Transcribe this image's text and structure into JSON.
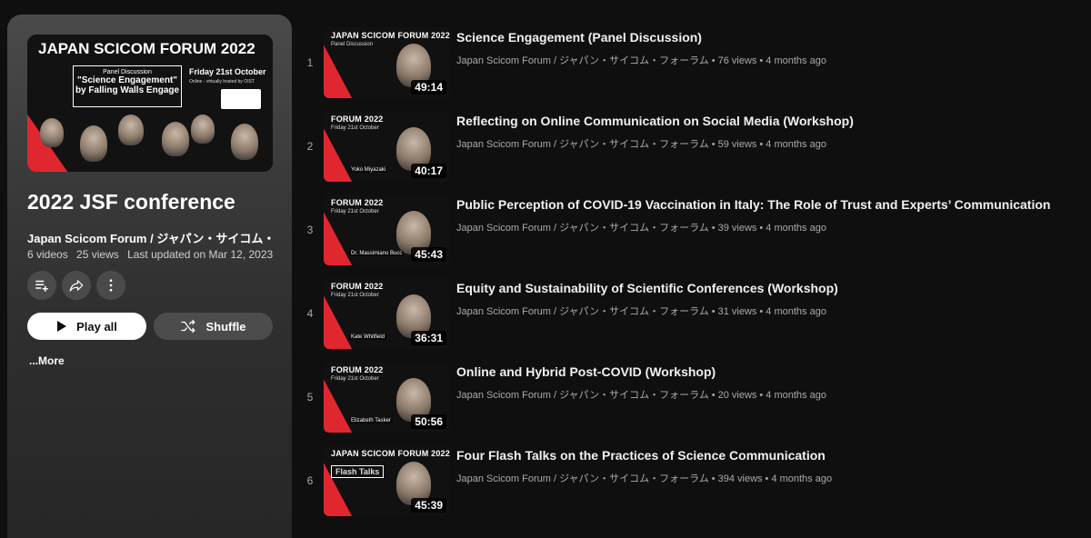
{
  "playlist": {
    "thumb_heading": "JAPAN SCICOM FORUM 2022",
    "thumb_panel": "Panel Discussion",
    "thumb_topic": "\"Science Engagement\"",
    "thumb_by": "by Falling Walls Engage",
    "thumb_date": "Friday 21st October",
    "thumb_online": "Online - virtually hosted by OIST",
    "title": "2022 JSF conference",
    "owner": "Japan Scicom Forum / ジャパン・サイコム・",
    "videos": "6 videos",
    "views": "25 views",
    "updated": "Last updated on Mar 12, 2023",
    "play_all": "Play all",
    "shuffle": "Shuffle",
    "more": "...More"
  },
  "videos": [
    {
      "index": "1",
      "title": "Science Engagement (Panel Discussion)",
      "channel": "Japan Scicom Forum / ジャパン・サイコム・フォーラム",
      "views": "76 views",
      "age": "4 months ago",
      "duration": "49:14",
      "thumb_text": "JAPAN SCICOM FORUM 2022",
      "thumb_sub": "Panel Discussion",
      "thumb_name": ""
    },
    {
      "index": "2",
      "title": "Reflecting on Online Communication on Social Media (Workshop)",
      "channel": "Japan Scicom Forum / ジャパン・サイコム・フォーラム",
      "views": "59 views",
      "age": "4 months ago",
      "duration": "40:17",
      "thumb_text": "FORUM 2022",
      "thumb_sub": "Friday 21st October",
      "thumb_name": "Yoko Miyazaki"
    },
    {
      "index": "3",
      "title": "Public Perception of COVID-19 Vaccination in Italy: The Role of Trust and Experts’ Communication",
      "channel": "Japan Scicom Forum / ジャパン・サイコム・フォーラム",
      "views": "39 views",
      "age": "4 months ago",
      "duration": "45:43",
      "thumb_text": "FORUM 2022",
      "thumb_sub": "Friday 21st October",
      "thumb_name": "Dr. Massimiano Bucc"
    },
    {
      "index": "4",
      "title": "Equity and Sustainability of Scientific Conferences (Workshop)",
      "channel": "Japan Scicom Forum / ジャパン・サイコム・フォーラム",
      "views": "31 views",
      "age": "4 months ago",
      "duration": "36:31",
      "thumb_text": "FORUM 2022",
      "thumb_sub": "Friday 21st October",
      "thumb_name": "Kate Whitfield"
    },
    {
      "index": "5",
      "title": "Online and Hybrid Post-COVID (Workshop)",
      "channel": "Japan Scicom Forum / ジャパン・サイコム・フォーラム",
      "views": "20 views",
      "age": "4 months ago",
      "duration": "50:56",
      "thumb_text": "FORUM 2022",
      "thumb_sub": "Friday 21st October",
      "thumb_name": "Elizabeth Tasker"
    },
    {
      "index": "6",
      "title": "Four Flash Talks on the Practices of Science Communication",
      "channel": "Japan Scicom Forum / ジャパン・サイコム・フォーラム",
      "views": "394 views",
      "age": "4 months ago",
      "duration": "45:39",
      "thumb_text": "JAPAN SCICOM FORUM 2022",
      "thumb_sub": "Flash Talks",
      "thumb_name": ""
    }
  ],
  "colors": {
    "background": "#0f0f0f",
    "accent_red": "#e0272f",
    "muted_text": "#aaaaaa"
  },
  "icons": [
    "add-to-queue-icon",
    "share-icon",
    "more-vert-icon",
    "play-icon",
    "shuffle-icon"
  ]
}
